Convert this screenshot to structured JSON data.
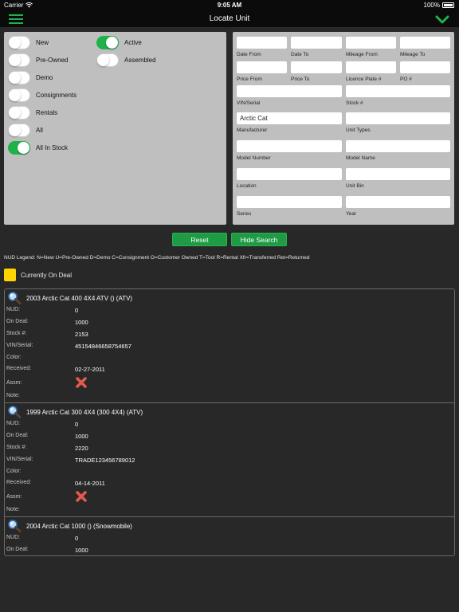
{
  "status_bar": {
    "carrier": "Carrier",
    "time": "9:05 AM",
    "battery": "100%"
  },
  "header": {
    "title": "Locate Unit"
  },
  "toggles": [
    {
      "label": "New",
      "on": false
    },
    {
      "label": "Active",
      "on": true
    },
    {
      "label": "Pre-Owned",
      "on": false
    },
    {
      "label": "Assembled",
      "on": false
    },
    {
      "label": "Demo",
      "on": false
    },
    {
      "label": "Consignments",
      "on": false
    },
    {
      "label": "Rentals",
      "on": false
    },
    {
      "label": "All",
      "on": false
    },
    {
      "label": "All In Stock",
      "on": true
    }
  ],
  "fields": {
    "date_from": {
      "label": "Date From",
      "value": ""
    },
    "date_to": {
      "label": "Date To",
      "value": ""
    },
    "mileage_from": {
      "label": "Mileage From",
      "value": ""
    },
    "mileage_to": {
      "label": "Mileage To",
      "value": ""
    },
    "price_from": {
      "label": "Price From",
      "value": ""
    },
    "price_to": {
      "label": "Price To",
      "value": ""
    },
    "licence_plate": {
      "label": "Licence Plate #",
      "value": ""
    },
    "po": {
      "label": "PO #",
      "value": ""
    },
    "vin_serial": {
      "label": "VIN/Serial",
      "value": ""
    },
    "stock": {
      "label": "Stock #",
      "value": ""
    },
    "manufacturer": {
      "label": "Manufacturer",
      "value": "Arctic Cat"
    },
    "unit_types": {
      "label": "Unit Types",
      "value": ""
    },
    "model_number": {
      "label": "Model Number",
      "value": ""
    },
    "model_name": {
      "label": "Model Name",
      "value": ""
    },
    "location": {
      "label": "Location",
      "value": ""
    },
    "unit_bin": {
      "label": "Unit Bin",
      "value": ""
    },
    "series": {
      "label": "Series",
      "value": ""
    },
    "year": {
      "label": "Year",
      "value": ""
    }
  },
  "buttons": {
    "reset": "Reset",
    "hide_search": "Hide Search"
  },
  "legend": "NUD Legend:  N=New  U=Pre-Owned  D=Demo  C=Consignment  O=Customer Owned  T=Tool  R=Rental  Xfr=Transferred  Ret=Returned",
  "deal_legend": {
    "label": "Currently On Deal",
    "color": "#ffd400"
  },
  "row_labels": {
    "nud": "NUD:",
    "on_deal": "On Deal:",
    "stock": "Stock #:",
    "vin": "VIN/Serial:",
    "color": "Color:",
    "received": "Received:",
    "assm": "Assm:",
    "note": "Note:"
  },
  "results": [
    {
      "title": "2003 Arctic Cat 400 4X4 ATV  () (ATV)",
      "nud": "0",
      "on_deal": "1000",
      "stock": "2153",
      "vin": "451548466587546​57",
      "color": "",
      "received": "02-27-2011",
      "assm": "no",
      "note": ""
    },
    {
      "title": "1999 Arctic Cat 300  4X4 (300  4X4) (ATV)",
      "nud": "0",
      "on_deal": "1000",
      "stock": "2220",
      "vin": "TRADE123456789012",
      "color": "",
      "received": "04-14-2011",
      "assm": "no",
      "note": ""
    },
    {
      "title": "2004 Arctic Cat 1000 () (Snowmobile)",
      "nud": "0",
      "on_deal": "1000"
    }
  ]
}
